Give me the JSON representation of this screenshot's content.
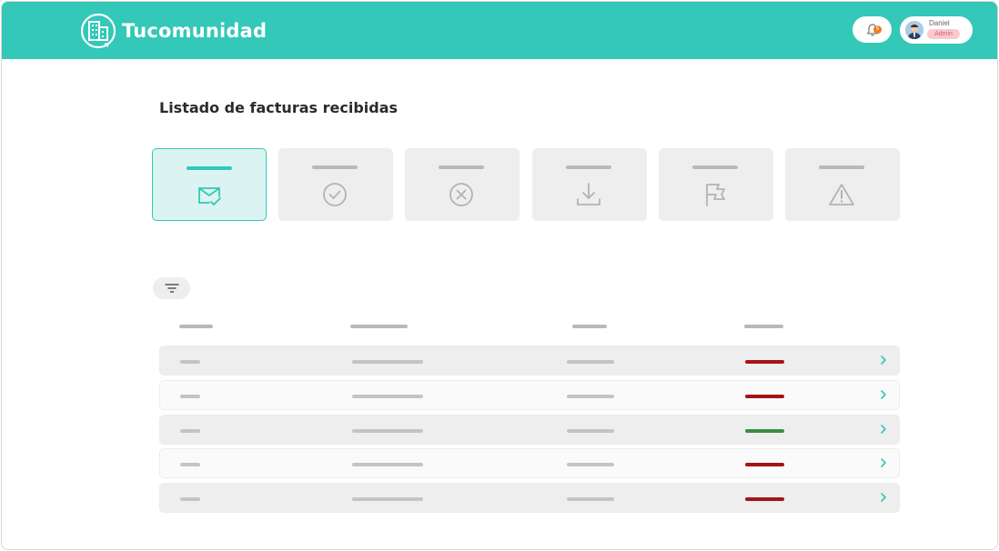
{
  "app": {
    "brand": "Tucomunidad"
  },
  "header": {
    "notifications": {
      "count": "5"
    },
    "user": {
      "name": "Daniel",
      "role": "Admin"
    }
  },
  "page": {
    "title": "Listado de facturas recibidas"
  },
  "filters": [
    {
      "id": "received",
      "icon": "envelope-check-icon",
      "active": true
    },
    {
      "id": "approved",
      "icon": "check-circle-icon",
      "active": false
    },
    {
      "id": "rejected",
      "icon": "x-circle-icon",
      "active": false
    },
    {
      "id": "downloaded",
      "icon": "download-icon",
      "active": false
    },
    {
      "id": "flagged",
      "icon": "flag-icon",
      "active": false
    },
    {
      "id": "warning",
      "icon": "warning-triangle-icon",
      "active": false
    }
  ],
  "table": {
    "rows": [
      {
        "status": "red",
        "status_color": "#a51414"
      },
      {
        "status": "red",
        "status_color": "#a51414"
      },
      {
        "status": "green",
        "status_color": "#3a8d4a"
      },
      {
        "status": "red",
        "status_color": "#a51414"
      },
      {
        "status": "red",
        "status_color": "#a51414"
      }
    ]
  },
  "colors": {
    "accent": "#33c8b8",
    "placeholder": "#c4c4c4",
    "badge": "#f07a1e"
  }
}
